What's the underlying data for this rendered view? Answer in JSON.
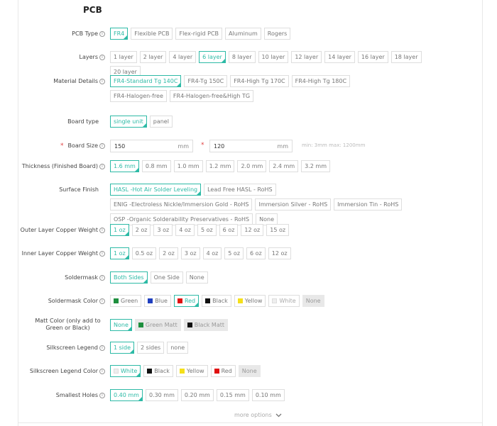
{
  "title": "PCB",
  "rows": {
    "pcb_type": {
      "label": "PCB Type",
      "options": [
        "FR4",
        "Flexible PCB",
        "Flex-rigid PCB",
        "Aluminum",
        "Rogers"
      ]
    },
    "layers": {
      "label": "Layers",
      "options": [
        "1 layer",
        "2 layer",
        "4 layer",
        "6 layer",
        "8 layer",
        "10 layer",
        "12 layer",
        "14 layer",
        "16 layer",
        "18 layer",
        "20 layer"
      ]
    },
    "material": {
      "label": "Material Details",
      "options": [
        "FR4-Standard Tg 140C",
        "FR4-Tg 150C",
        "FR4-High Tg 170C",
        "FR4-High Tg 180C",
        "FR4-Halogen-free",
        "FR4-Halogen-free&High TG"
      ]
    },
    "board_type": {
      "label": "Board type",
      "options": [
        "single unit",
        "panel"
      ]
    },
    "board_size": {
      "label": "Board Size",
      "width": "150",
      "height": "120",
      "unit": "mm",
      "hint": "min: 3mm max: 1200mm"
    },
    "thickness": {
      "label": "Thickness (Finished Board)",
      "options": [
        "1.6 mm",
        "0.8 mm",
        "1.0 mm",
        "1.2 mm",
        "2.0 mm",
        "2.4 mm",
        "3.2 mm"
      ]
    },
    "surface": {
      "label": "Surface Finish",
      "options": [
        "HASL -Hot Air Solder Leveling",
        "Lead Free HASL - RoHS",
        "ENIG -Electroless Nickle/Immersion Gold - RoHS",
        "Immersion Silver - RoHS",
        "Immersion Tin - RoHS",
        "OSP -Organic Solderability Preservatives - RoHS",
        "None"
      ]
    },
    "outer_copper": {
      "label": "Outer Layer Copper Weight",
      "options": [
        "1 oz",
        "2 oz",
        "3 oz",
        "4 oz",
        "5 oz",
        "6 oz",
        "12 oz",
        "15 oz"
      ]
    },
    "inner_copper": {
      "label": "Inner Layer Copper Weight",
      "options": [
        "1 oz",
        "0.5 oz",
        "2 oz",
        "3 oz",
        "4 oz",
        "5 oz",
        "6 oz",
        "12 oz"
      ]
    },
    "soldermask": {
      "label": "Soldermask",
      "options": [
        "Both Sides",
        "One Side",
        "None"
      ]
    },
    "soldermask_color": {
      "label": "Soldermask Color",
      "options": [
        "Green",
        "Blue",
        "Red",
        "Black",
        "Yellow",
        "White",
        "None"
      ]
    },
    "matt_color": {
      "label": "Matt Color (only add to Green or Black)",
      "options": [
        "None",
        "Green Matt",
        "Black Matt"
      ]
    },
    "silkscreen": {
      "label": "Silkscreen Legend",
      "options": [
        "1 side",
        "2 sides",
        "none"
      ]
    },
    "silkscreen_color": {
      "label": "Silkscreen Legend Color",
      "options": [
        "White",
        "Black",
        "Yellow",
        "Red",
        "None"
      ]
    },
    "holes": {
      "label": "Smallest Holes",
      "options": [
        "0.40 mm",
        "0.30 mm",
        "0.20 mm",
        "0.15 mm",
        "0.10 mm"
      ]
    }
  },
  "more_options": "more options",
  "colors": {
    "accent": "#2dbaa6",
    "green": "#1e8f3e",
    "blue": "#1f3fbf",
    "red": "#e01010",
    "black": "#111111",
    "yellow": "#f5e01a",
    "white": "#eeeeee"
  },
  "icons": {
    "info": "info-icon",
    "more": "chevron-down-icon"
  }
}
